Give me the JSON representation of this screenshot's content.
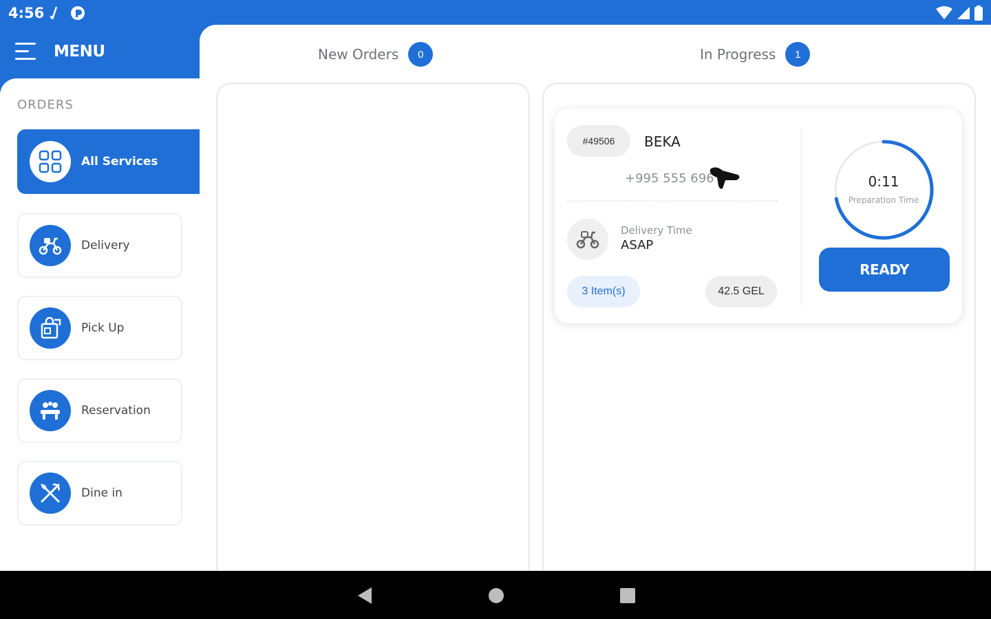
{
  "status_bar": {
    "time": "4:56",
    "left_icons": [
      "cast-icon",
      "app-icon"
    ],
    "right_icons": [
      "wifi-icon",
      "signal-icon",
      "battery-icon"
    ]
  },
  "sidebar": {
    "menu_label": "MENU",
    "orders_heading": "ORDERS",
    "items": [
      {
        "label": "All Services",
        "icon": "grid-icon",
        "active": true
      },
      {
        "label": "Delivery",
        "icon": "scooter-icon",
        "active": false
      },
      {
        "label": "Pick Up",
        "icon": "pickup-icon",
        "active": false
      },
      {
        "label": "Reservation",
        "icon": "reservation-icon",
        "active": false
      },
      {
        "label": "Dine in",
        "icon": "utensils-icon",
        "active": false
      }
    ]
  },
  "tabs": {
    "new_orders": {
      "label": "New Orders",
      "count": "0"
    },
    "in_progress": {
      "label": "In Progress",
      "count": "1"
    }
  },
  "order": {
    "id": "#49506",
    "customer_name": "BEKA",
    "phone": "+995 555 696",
    "delivery_time_label": "Delivery Time",
    "delivery_time_value": "ASAP",
    "items": "3 Item(s)",
    "price": "42.5 GEL",
    "timer_value": "0:11",
    "timer_label": "Preparation Time",
    "timer_progress": 0.72,
    "ready_label": "READY"
  },
  "colors": {
    "primary": "#1f6fd6",
    "nav_bar": "#000000"
  }
}
